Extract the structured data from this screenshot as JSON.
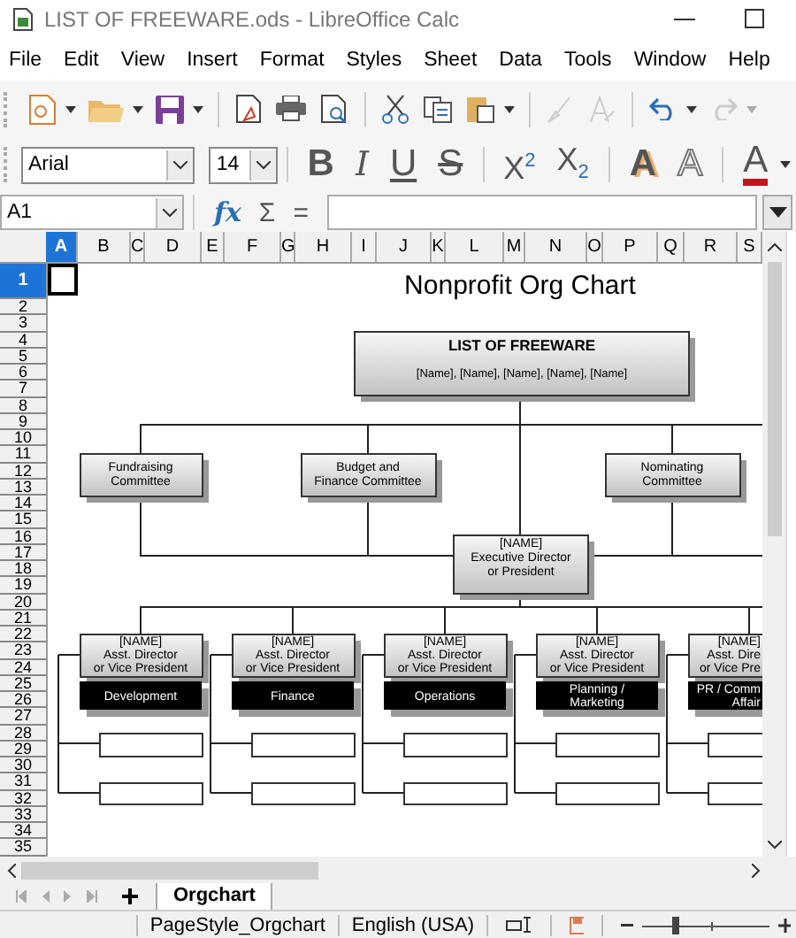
{
  "window": {
    "title": "LIST OF FREEWARE.ods - LibreOffice Calc"
  },
  "menu": [
    "File",
    "Edit",
    "View",
    "Insert",
    "Format",
    "Styles",
    "Sheet",
    "Data",
    "Tools",
    "Window",
    "Help"
  ],
  "formatting": {
    "font_name": "Arial",
    "font_size": "14",
    "buttons": [
      {
        "label": "B",
        "kind": "bold"
      },
      {
        "label": "I",
        "kind": "italic"
      },
      {
        "label": "U",
        "kind": "underline"
      },
      {
        "label": "S",
        "kind": "strike"
      },
      {
        "label": "X$^{2}$",
        "kind": "super"
      },
      {
        "label": "X$_{2}$",
        "kind": "sub"
      },
      {
        "label": "A",
        "kind": "shadow"
      },
      {
        "label": "A",
        "kind": "outline"
      },
      {
        "label": "A",
        "kind": "color"
      }
    ]
  },
  "formula_bar": {
    "cell_ref": "A1",
    "buttons": [
      "fx",
      "Σ",
      "="
    ]
  },
  "columns": [
    {
      "label": "A",
      "selected": true
    },
    {
      "label": "B",
      "selected": false
    },
    {
      "label": "C",
      "selected": false
    },
    {
      "label": "D",
      "selected": false
    },
    {
      "label": "E",
      "selected": false
    },
    {
      "label": "F",
      "selected": false
    },
    {
      "label": "G",
      "selected": false
    },
    {
      "label": "H",
      "selected": false
    },
    {
      "label": "I",
      "selected": false
    },
    {
      "label": "J",
      "selected": false
    },
    {
      "label": "K",
      "selected": false
    },
    {
      "label": "L",
      "selected": false
    },
    {
      "label": "M",
      "selected": false
    },
    {
      "label": "N",
      "selected": false
    },
    {
      "label": "O",
      "selected": false
    },
    {
      "label": "P",
      "selected": false
    },
    {
      "label": "Q",
      "selected": false
    },
    {
      "label": "R",
      "selected": false
    },
    {
      "label": "S",
      "selected": false
    }
  ],
  "rows": [
    {
      "label": "1",
      "selected": true
    },
    {
      "label": "2",
      "selected": false
    },
    {
      "label": "3",
      "selected": false
    },
    {
      "label": "4",
      "selected": false
    },
    {
      "label": "5",
      "selected": false
    },
    {
      "label": "6",
      "selected": false
    },
    {
      "label": "7",
      "selected": false
    },
    {
      "label": "8",
      "selected": false
    },
    {
      "label": "9",
      "selected": false
    },
    {
      "label": "10",
      "selected": false
    },
    {
      "label": "11",
      "selected": false
    },
    {
      "label": "12",
      "selected": false
    },
    {
      "label": "13",
      "selected": false
    },
    {
      "label": "14",
      "selected": false
    },
    {
      "label": "15",
      "selected": false
    },
    {
      "label": "16",
      "selected": false
    },
    {
      "label": "17",
      "selected": false
    },
    {
      "label": "18",
      "selected": false
    },
    {
      "label": "19",
      "selected": false
    },
    {
      "label": "20",
      "selected": false
    },
    {
      "label": "21",
      "selected": false
    },
    {
      "label": "22",
      "selected": false
    },
    {
      "label": "23",
      "selected": false
    },
    {
      "label": "24",
      "selected": false
    },
    {
      "label": "25",
      "selected": false
    },
    {
      "label": "26",
      "selected": false
    },
    {
      "label": "27",
      "selected": false
    },
    {
      "label": "28",
      "selected": false
    },
    {
      "label": "29",
      "selected": false
    },
    {
      "label": "30",
      "selected": false
    },
    {
      "label": "31",
      "selected": false
    },
    {
      "label": "32",
      "selected": false
    },
    {
      "label": "33",
      "selected": false
    },
    {
      "label": "34",
      "selected": false
    },
    {
      "label": "35",
      "selected": false
    }
  ],
  "chart": {
    "title": "Nonprofit Org Chart",
    "board": {
      "title": "LIST OF FREEWARE",
      "names": "[Name], [Name], [Name], [Name], [Name]"
    },
    "committees": [
      {
        "lines": [
          "Fundraising",
          "Committee"
        ]
      },
      {
        "lines": [
          "Budget and",
          "Finance Committee"
        ]
      },
      {
        "lines": [
          "Nominating",
          "Committee"
        ]
      }
    ],
    "executive": [
      "[NAME]",
      "Executive Director",
      "or President"
    ],
    "directors": [
      {
        "lines": [
          "[NAME]",
          "Asst. Director",
          "or Vice President"
        ],
        "department": [
          "Development"
        ]
      },
      {
        "lines": [
          "[NAME]",
          "Asst. Director",
          "or Vice President"
        ],
        "department": [
          "Finance"
        ]
      },
      {
        "lines": [
          "[NAME]",
          "Asst. Director",
          "or Vice President"
        ],
        "department": [
          "Operations"
        ]
      },
      {
        "lines": [
          "[NAME]",
          "Asst. Director",
          "or Vice President"
        ],
        "department": [
          "Planning /",
          "Marketing"
        ]
      },
      {
        "lines": [
          "[NAME]",
          "Asst. Dire",
          "or Vice Pre"
        ],
        "department": [
          "PR / Comm",
          "Affair"
        ]
      }
    ]
  },
  "sheet_tabs": [
    {
      "label": "Orgchart",
      "selected": true
    }
  ],
  "status_bar": {
    "page_style": "PageStyle_Orgchart",
    "language": "English (USA)",
    "zoom": {
      "level": 0.23
    }
  }
}
